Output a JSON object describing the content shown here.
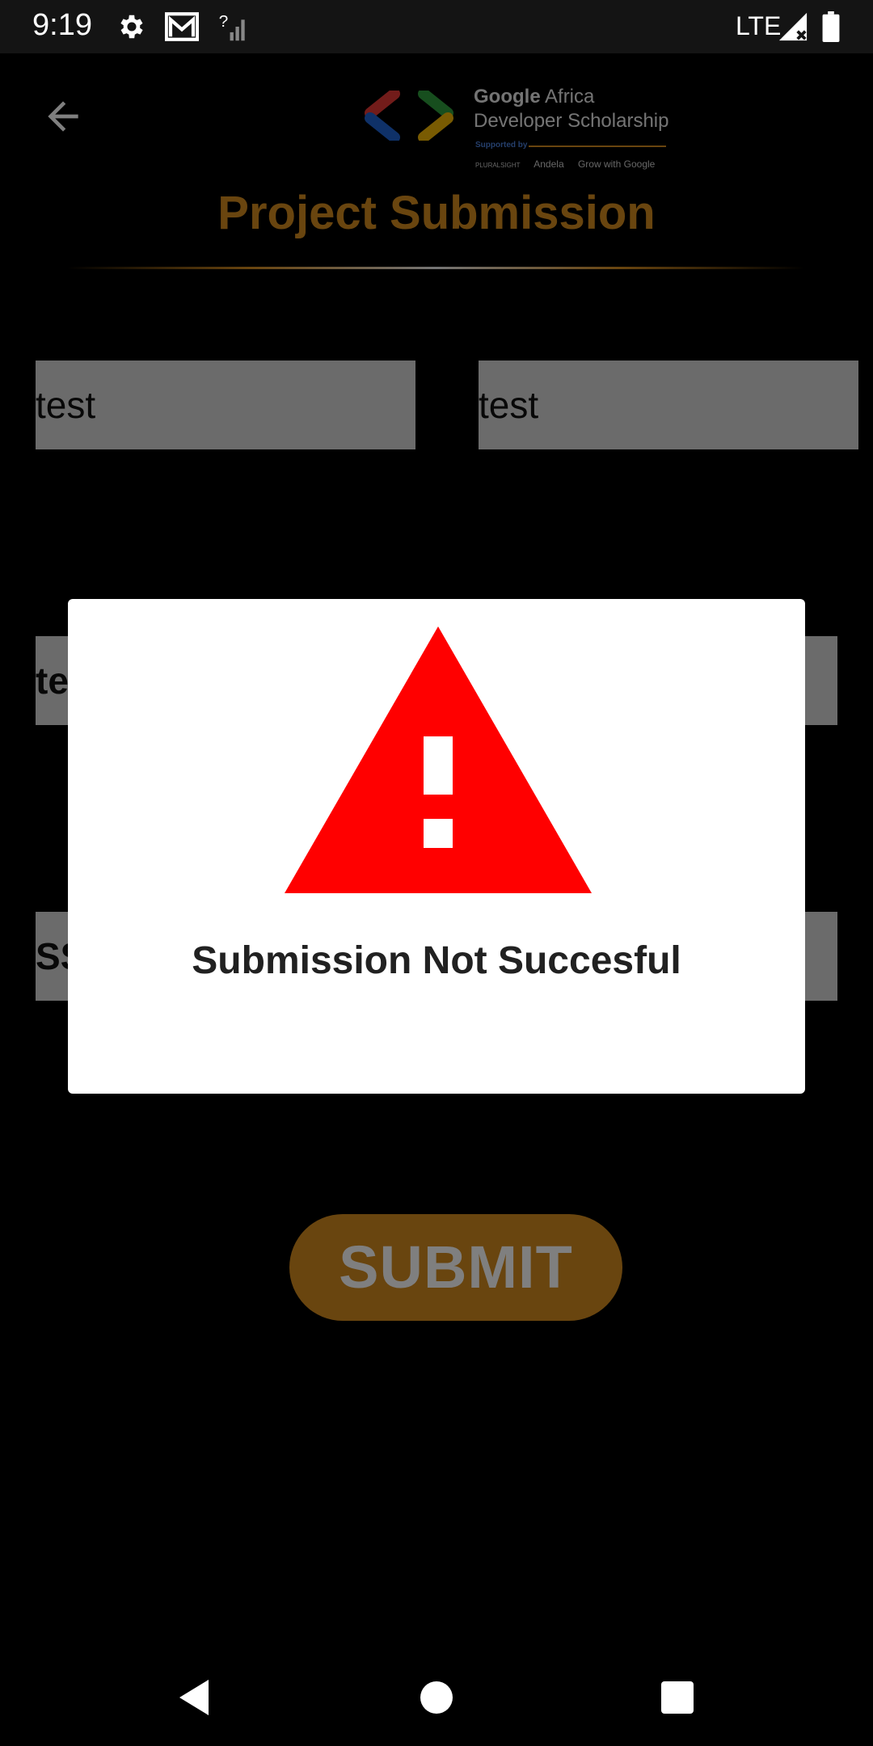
{
  "status_bar": {
    "time": "9:19",
    "network": "LTE",
    "icons": [
      "settings-icon",
      "gmail-icon",
      "signal-unknown-icon",
      "cell-signal-icon",
      "battery-icon"
    ]
  },
  "header": {
    "back_icon": "arrow-back-icon",
    "logo": {
      "google": "Google",
      "africa": "Africa",
      "line2": "Developer Scholarship",
      "supported_by": "Supported by",
      "partners": [
        "PLURALSIGHT",
        "Andela",
        "Grow with Google"
      ]
    }
  },
  "page": {
    "title": "Project Submission",
    "fields": {
      "first_name": "test",
      "last_name": "test",
      "email": "te",
      "github_link": "SS"
    },
    "submit_label": "SUBMIT"
  },
  "dialog": {
    "icon": "warning-triangle-icon",
    "message": "Submission Not Succesful"
  },
  "nav_bar": {
    "icons": [
      "nav-back-icon",
      "nav-home-icon",
      "nav-recents-icon"
    ]
  },
  "colors": {
    "accent": "#d38a1e",
    "warning": "#ff0000",
    "field_bg": "#d6d6d6"
  }
}
